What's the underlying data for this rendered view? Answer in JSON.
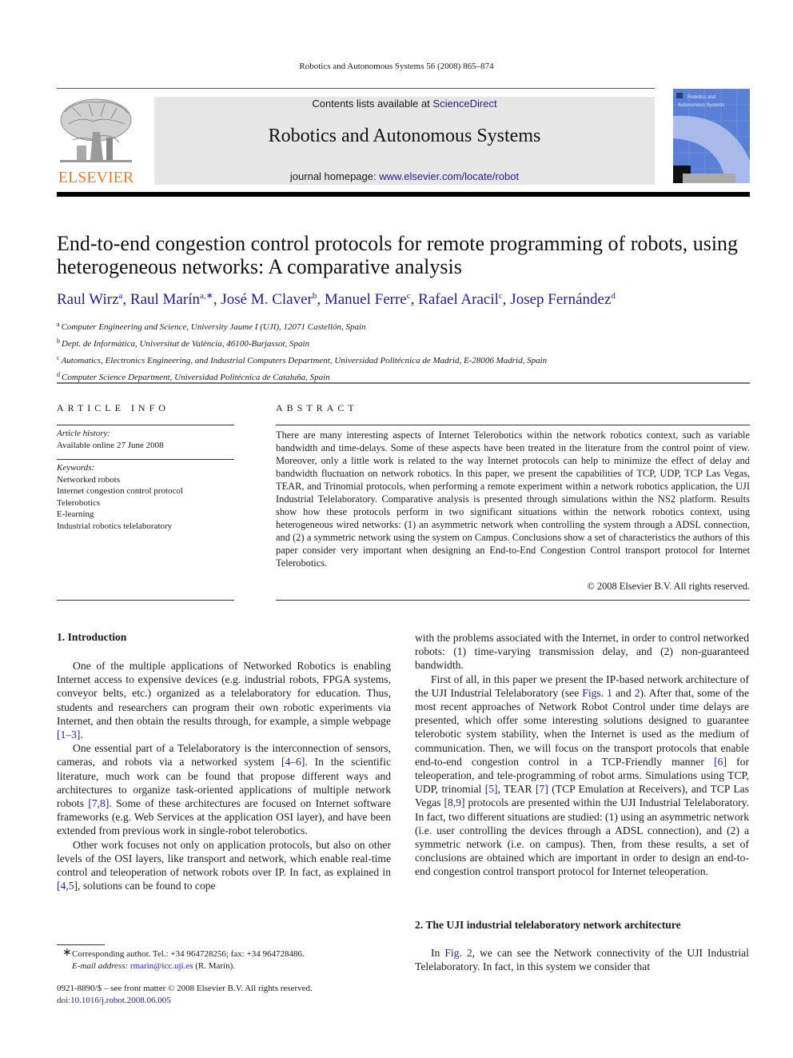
{
  "running_head": "Robotics and Autonomous Systems 56 (2008) 865–874",
  "banner": {
    "contents_prefix": "Contents lists available at ",
    "contents_link": "ScienceDirect",
    "journal_name": "Robotics and Autonomous Systems",
    "homepage_prefix": "journal homepage: ",
    "homepage_link": "www.elsevier.com/locate/robot"
  },
  "publisher_logo": {
    "wordmark": "ELSEVIER",
    "icon": "elsevier-tree-icon",
    "color": "#f47b20"
  },
  "cover": {
    "title_line1": "Robotics and",
    "title_line2": "Autonomous Systems",
    "color": "#5a7fd6"
  },
  "article": {
    "title": "End-to-end congestion control protocols for remote programming of robots, using heterogeneous networks: A comparative analysis",
    "authors": [
      {
        "name": "Raul Wirz",
        "sup": "a"
      },
      {
        "name": "Raul Marín",
        "sup": "a,∗"
      },
      {
        "name": "José M. Claver",
        "sup": "b"
      },
      {
        "name": "Manuel Ferre",
        "sup": "c"
      },
      {
        "name": "Rafael Aracil",
        "sup": "c"
      },
      {
        "name": "Josep Fernández",
        "sup": "d"
      }
    ],
    "affiliations": [
      {
        "sup": "a",
        "text": "Computer Engineering and Science, University Jaume I (UJI), 12071 Castellón, Spain"
      },
      {
        "sup": "b",
        "text": "Dept. de Informàtica, Universitat de València, 46100-Burjassot, Spain"
      },
      {
        "sup": "c",
        "text": "Automatics, Electronics Engineering, and Industrial Computers Department, Universidad Politécnica de Madrid, E-28006 Madrid, Spain"
      },
      {
        "sup": "d",
        "text": "Computer Science Department, Universidad Politécnica de Cataluña, Spain"
      }
    ]
  },
  "article_info": {
    "heading": "ARTICLE INFO",
    "history_label": "Article history:",
    "history_value": "Available online 27 June 2008",
    "keywords_label": "Keywords:",
    "keywords": [
      "Networked robots",
      "Internet congestion control protocol",
      "Telerobotics",
      "E-learning",
      "Industrial robotics telelaboratory"
    ]
  },
  "abstract": {
    "heading": "ABSTRACT",
    "text": "There are many interesting aspects of Internet Telerobotics within the network robotics context, such as variable bandwidth and time-delays. Some of these aspects have been treated in the literature from the control point of view. Moreover, only a little work is related to the way Internet protocols can help to minimize the effect of delay and bandwidth fluctuation on network robotics. In this paper, we present the capabilities of TCP, UDP, TCP Las Vegas, TEAR, and Trinomial protocols, when performing a remote experiment within a network robotics application, the UJI Industrial Telelaboratory. Comparative analysis is presented through simulations within the NS2 platform. Results show how these protocols perform in two significant situations within the network robotics context, using heterogeneous wired networks: (1) an asymmetric network when controlling the system through a ADSL connection, and (2) a symmetric network using the system on Campus. Conclusions show a set of characteristics the authors of this paper consider very important when designing an End-to-End Congestion Control transport protocol for Internet Telerobotics.",
    "copyright": "© 2008 Elsevier B.V. All rights reserved."
  },
  "sections": {
    "s1_heading": "1.  Introduction",
    "s1_p1_a": "One of the multiple applications of Networked Robotics is enabling Internet access to expensive devices (e.g. industrial robots, FPGA systems, conveyor belts, etc.) organized as a telelaboratory for education. Thus, students and researchers can program their own robotic experiments via Internet, and then obtain the results through, for example, a simple webpage ",
    "s1_p1_ref": "[1–3]",
    "s1_p1_b": ".",
    "s1_p2_a": "One essential part of a Telelaboratory is the interconnection of sensors, cameras, and robots via a networked system ",
    "s1_p2_ref1": "[4–6]",
    "s1_p2_b": ". In the scientific literature, much work can be found that propose different ways and architectures to organize task-oriented applications of multiple network robots ",
    "s1_p2_ref2": "[7,8]",
    "s1_p2_c": ". Some of these architectures are focused on Internet software frameworks (e.g. Web Services at the application OSI layer), and have been extended from previous work in single-robot telerobotics.",
    "s1_p3_a": "Other work focuses not only on application protocols, but also on other levels of the OSI layers, like transport and network, which enable real-time control and teleoperation of network robots over IP. In fact, as explained in ",
    "s1_p3_ref": "[4,5]",
    "s1_p3_b": ", solutions can be found to cope",
    "r_p0": "with the problems associated with the Internet, in order to control networked robots: (1) time-varying transmission delay, and (2) non-guaranteed bandwidth.",
    "r_p1_a": "First of all, in this paper we present the IP-based network architecture of the UJI Industrial Telelaboratory (see ",
    "r_p1_ref1": "Figs. 1",
    "r_p1_and": " and ",
    "r_p1_ref2": "2",
    "r_p1_b": "). After that, some of the most recent approaches of Network Robot Control under time delays are presented, which offer some interesting solutions designed to guarantee telerobotic system stability, when the Internet is used as the medium of communication. Then, we will focus on the transport protocols that enable end-to-end congestion control in a TCP-Friendly manner ",
    "r_p1_ref3": "[6]",
    "r_p1_c": " for teleoperation, and tele-programming of robot arms.  Simulations using TCP, UDP, trinomial ",
    "r_p1_ref4": "[5]",
    "r_p1_d": ", TEAR ",
    "r_p1_ref5": "[7]",
    "r_p1_e": " (TCP Emulation at Receivers), and TCP Las Vegas ",
    "r_p1_ref6": "[8,9]",
    "r_p1_f": " protocols are presented within the UJI Industrial Telelaboratory. In fact, two different situations are studied: (1) using an asymmetric network (i.e. user controlling the devices through a ADSL connection), and (2) a symmetric network (i.e. on campus). Then, from these results, a set of conclusions are obtained which are important in order to design an end-to-end congestion control transport protocol for Internet teleoperation.",
    "s2_heading": "2.  The UJI industrial telelaboratory network architecture",
    "s2_p1_a": "In ",
    "s2_p1_ref": "Fig. 2",
    "s2_p1_b": ", we can see the Network connectivity of the UJI Industrial Telelaboratory. In fact, in this system we consider that"
  },
  "footnote": {
    "star": "∗",
    "line1": "Corresponding author. Tel.: +34 964728256; fax: +34 964728486.",
    "email_label": "E-mail address: ",
    "email": "rmarin@icc.uji.es",
    "email_suffix": " (R. Marín)."
  },
  "issn_line": "0921-8890/$ – see front matter © 2008 Elsevier B.V. All rights reserved.",
  "doi": "doi:10.1016/j.robot.2008.06.005"
}
